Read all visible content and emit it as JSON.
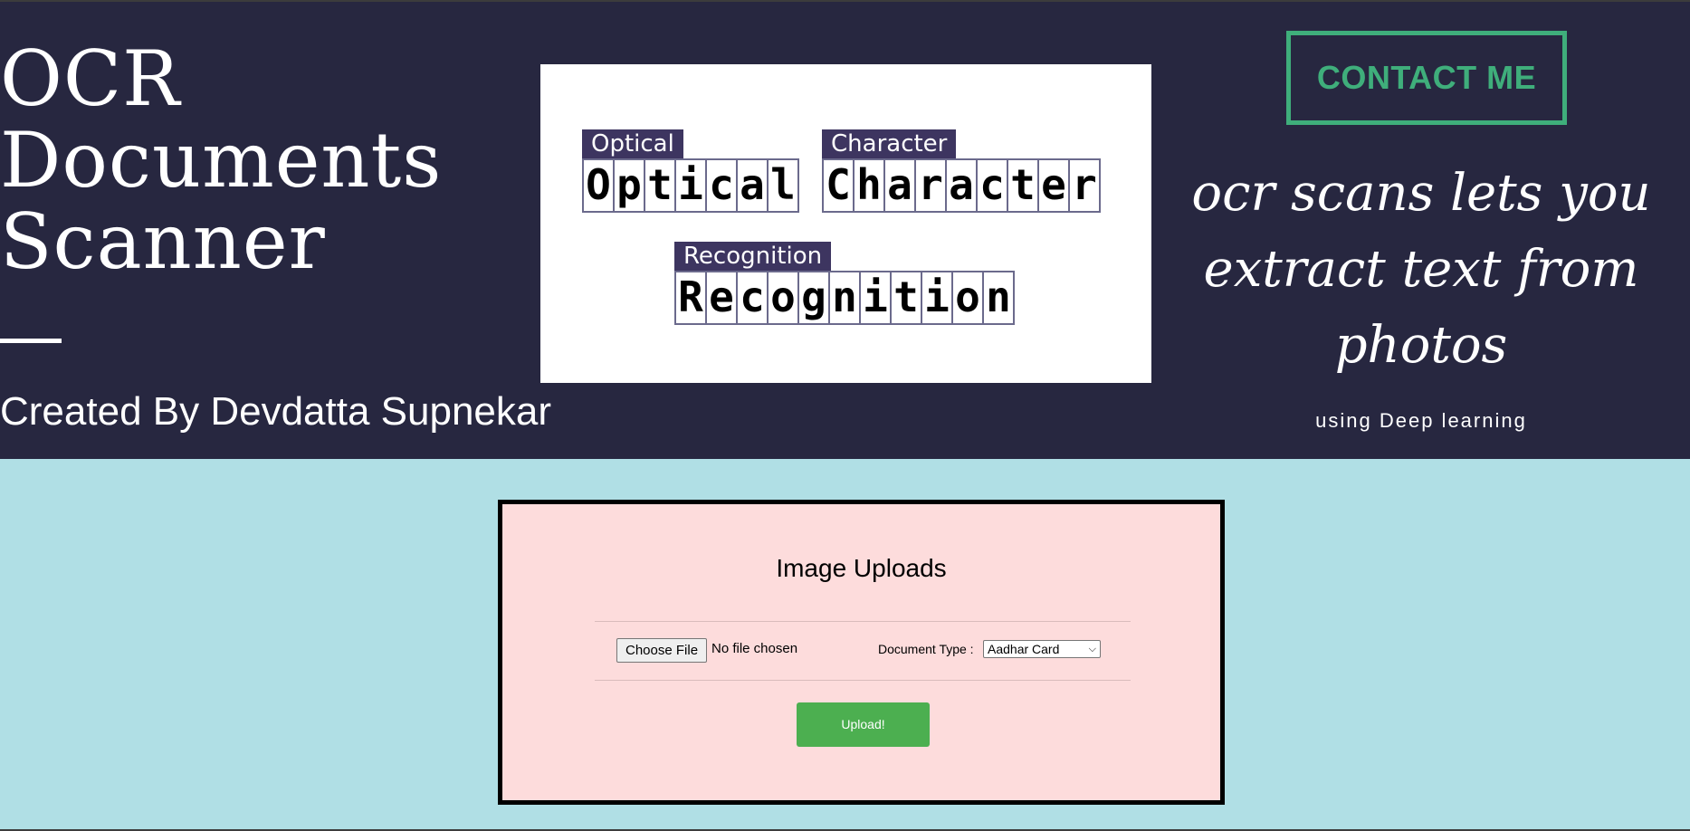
{
  "header": {
    "brand_lines": [
      "OCR",
      "Documents",
      "Scanner"
    ],
    "creator": "Created By Devdatta Supnekar",
    "hero_image": {
      "words": [
        {
          "tag": "Optical",
          "letters": [
            "O",
            "p",
            "t",
            "i",
            "c",
            "a",
            "l"
          ]
        },
        {
          "tag": "Character",
          "letters": [
            "C",
            "h",
            "a",
            "r",
            "a",
            "c",
            "t",
            "e",
            "r"
          ]
        },
        {
          "tag": "Recognition",
          "letters": [
            "R",
            "e",
            "c",
            "o",
            "g",
            "n",
            "i",
            "t",
            "i",
            "o",
            "n"
          ]
        }
      ]
    },
    "contact_label": "CONTACT ME",
    "tagline": "ocr scans lets you extract text from photos",
    "subtagline": "using Deep learning",
    "colors": {
      "banner_bg": "#272740",
      "accent": "#3fae7b"
    }
  },
  "upload_form": {
    "title": "Image Uploads",
    "file_button_label": "Choose File",
    "file_status": "No file chosen",
    "doc_type_label": "Document Type :",
    "doc_type_selected": "Aadhar Card",
    "submit_label": "Upload!",
    "colors": {
      "card_bg": "#fddcdc",
      "page_bg": "#b0dfe5",
      "submit_bg": "#4caf50"
    }
  }
}
